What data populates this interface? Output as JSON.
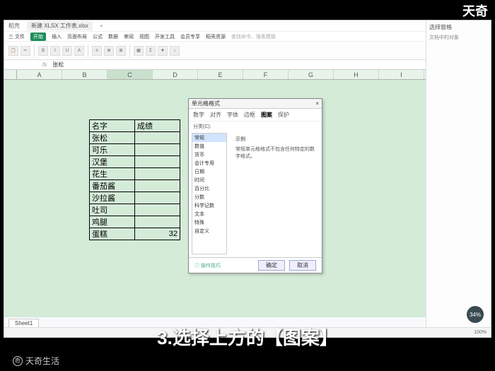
{
  "brand_top": "天奇",
  "brand_bottom": "天奇生活",
  "caption": "3.选择上方的【图案】",
  "titlebar": {
    "app": "稻壳",
    "file_tab": "新建 XLSX 工作表.xlsx",
    "plus": "+"
  },
  "menu": {
    "items": [
      "三 文件",
      "开始",
      "插入",
      "页面布局",
      "公式",
      "数据",
      "审阅",
      "视图",
      "开发工具",
      "会员专享",
      "稻壳资源"
    ],
    "active_index": 1,
    "search": "查找命令、搜索模板"
  },
  "formula": {
    "name_box": "",
    "fx": "fx",
    "value": "张松"
  },
  "columns": [
    "A",
    "B",
    "C",
    "D",
    "E",
    "F",
    "G",
    "H",
    "I"
  ],
  "panel": {
    "title": "选择窗格",
    "hint": "文档中的对象"
  },
  "table": {
    "headers": [
      "名字",
      "成绩"
    ],
    "rows": [
      [
        "张松",
        ""
      ],
      [
        "可乐",
        ""
      ],
      [
        "汉堡",
        ""
      ],
      [
        "花生",
        ""
      ],
      [
        "番茄酱",
        ""
      ],
      [
        "沙拉酱",
        ""
      ],
      [
        "吐司",
        ""
      ],
      [
        "鸡腿",
        ""
      ],
      [
        "蛋糕",
        "32"
      ]
    ]
  },
  "dialog": {
    "title": "单元格格式",
    "close": "×",
    "tabs": [
      "数字",
      "对齐",
      "字体",
      "边框",
      "图案",
      "保护"
    ],
    "active_tab": 4,
    "list_label": "分类(C):",
    "list": [
      "常规",
      "数值",
      "货币",
      "会计专用",
      "日期",
      "时间",
      "百分比",
      "分数",
      "科学记数",
      "文本",
      "特殊",
      "自定义"
    ],
    "list_selected": 0,
    "preview_label": "示例",
    "preview_text": "常规单元格格式不包含任何特定的数字格式。",
    "help": "操作技巧",
    "ok": "确定",
    "cancel": "取消"
  },
  "status": {
    "sheet": "Sheet1",
    "zoom": "100%",
    "badge": "34%"
  }
}
